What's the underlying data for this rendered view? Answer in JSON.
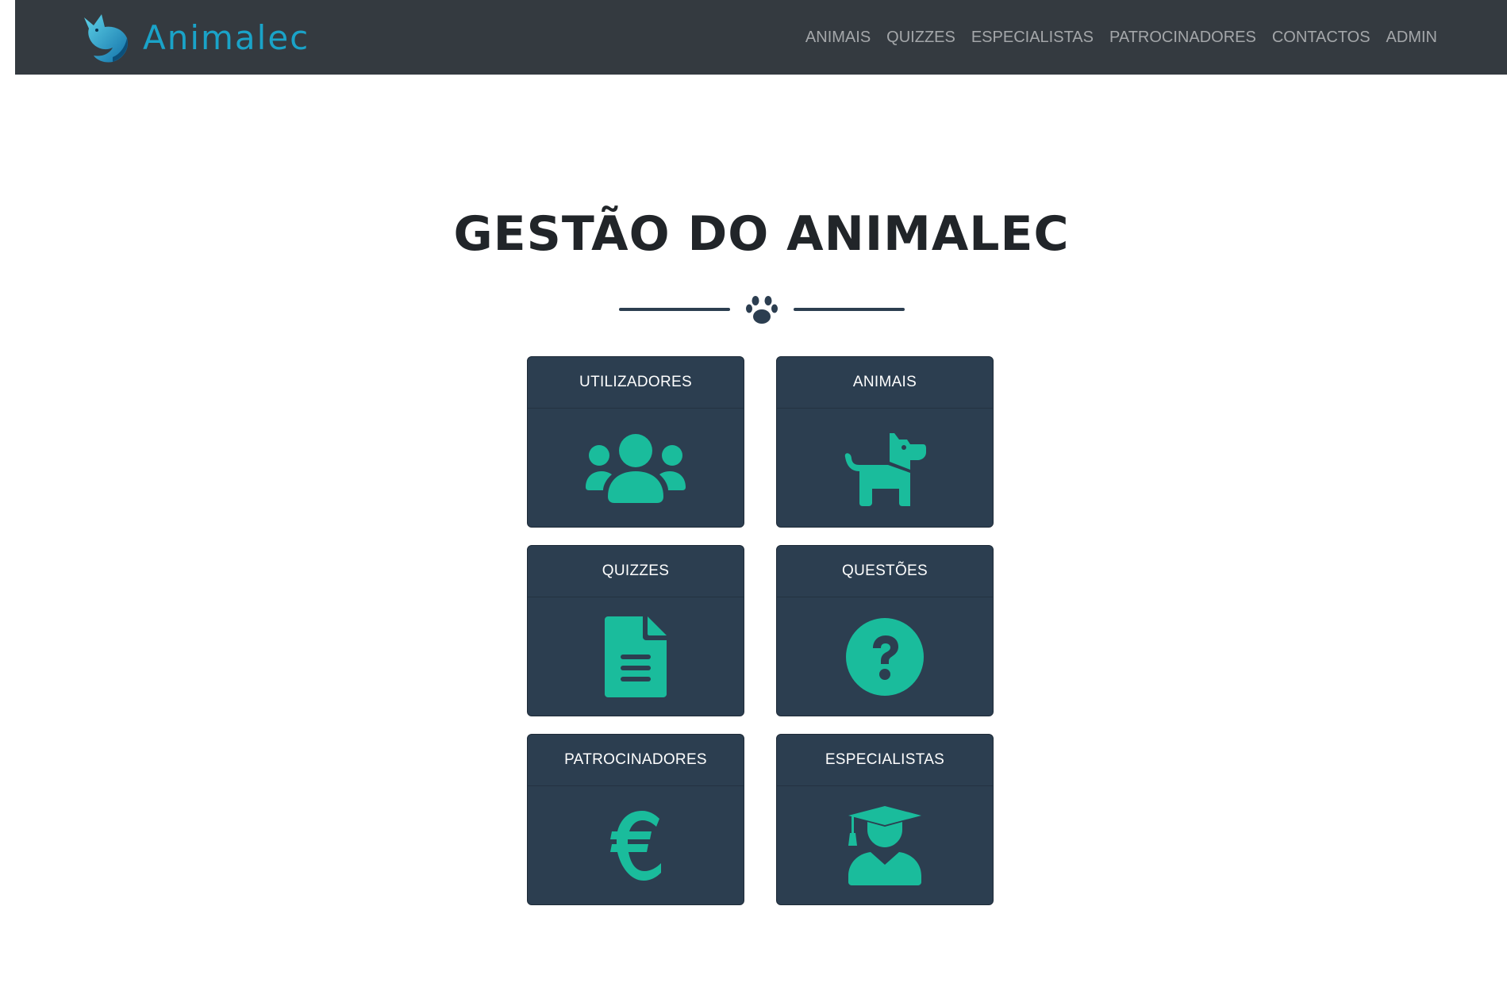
{
  "navbar": {
    "brand": "Animalec",
    "logo_icon": "fox-logo-icon",
    "links": [
      {
        "label": "ANIMAIS"
      },
      {
        "label": "QUIZZES"
      },
      {
        "label": "ESPECIALISTAS"
      },
      {
        "label": "PATROCINADORES"
      },
      {
        "label": "CONTACTOS"
      },
      {
        "label": "ADMIN"
      }
    ]
  },
  "main": {
    "title": "GESTÃO DO ANIMALEC",
    "divider_icon": "paw-icon",
    "cards": [
      {
        "label": "UTILIZADORES",
        "icon": "users-icon"
      },
      {
        "label": "ANIMAIS",
        "icon": "dog-icon"
      },
      {
        "label": "QUIZZES",
        "icon": "file-icon"
      },
      {
        "label": "QUESTÕES",
        "icon": "question-circle-icon"
      },
      {
        "label": "PATROCINADORES",
        "icon": "euro-icon"
      },
      {
        "label": "ESPECIALISTAS",
        "icon": "graduate-icon"
      }
    ]
  },
  "colors": {
    "navbar_bg": "#343a40",
    "brand": "#1aa3c8",
    "card_bg": "#2c3e50",
    "icon_accent": "#1abc9c",
    "title": "#212529"
  }
}
